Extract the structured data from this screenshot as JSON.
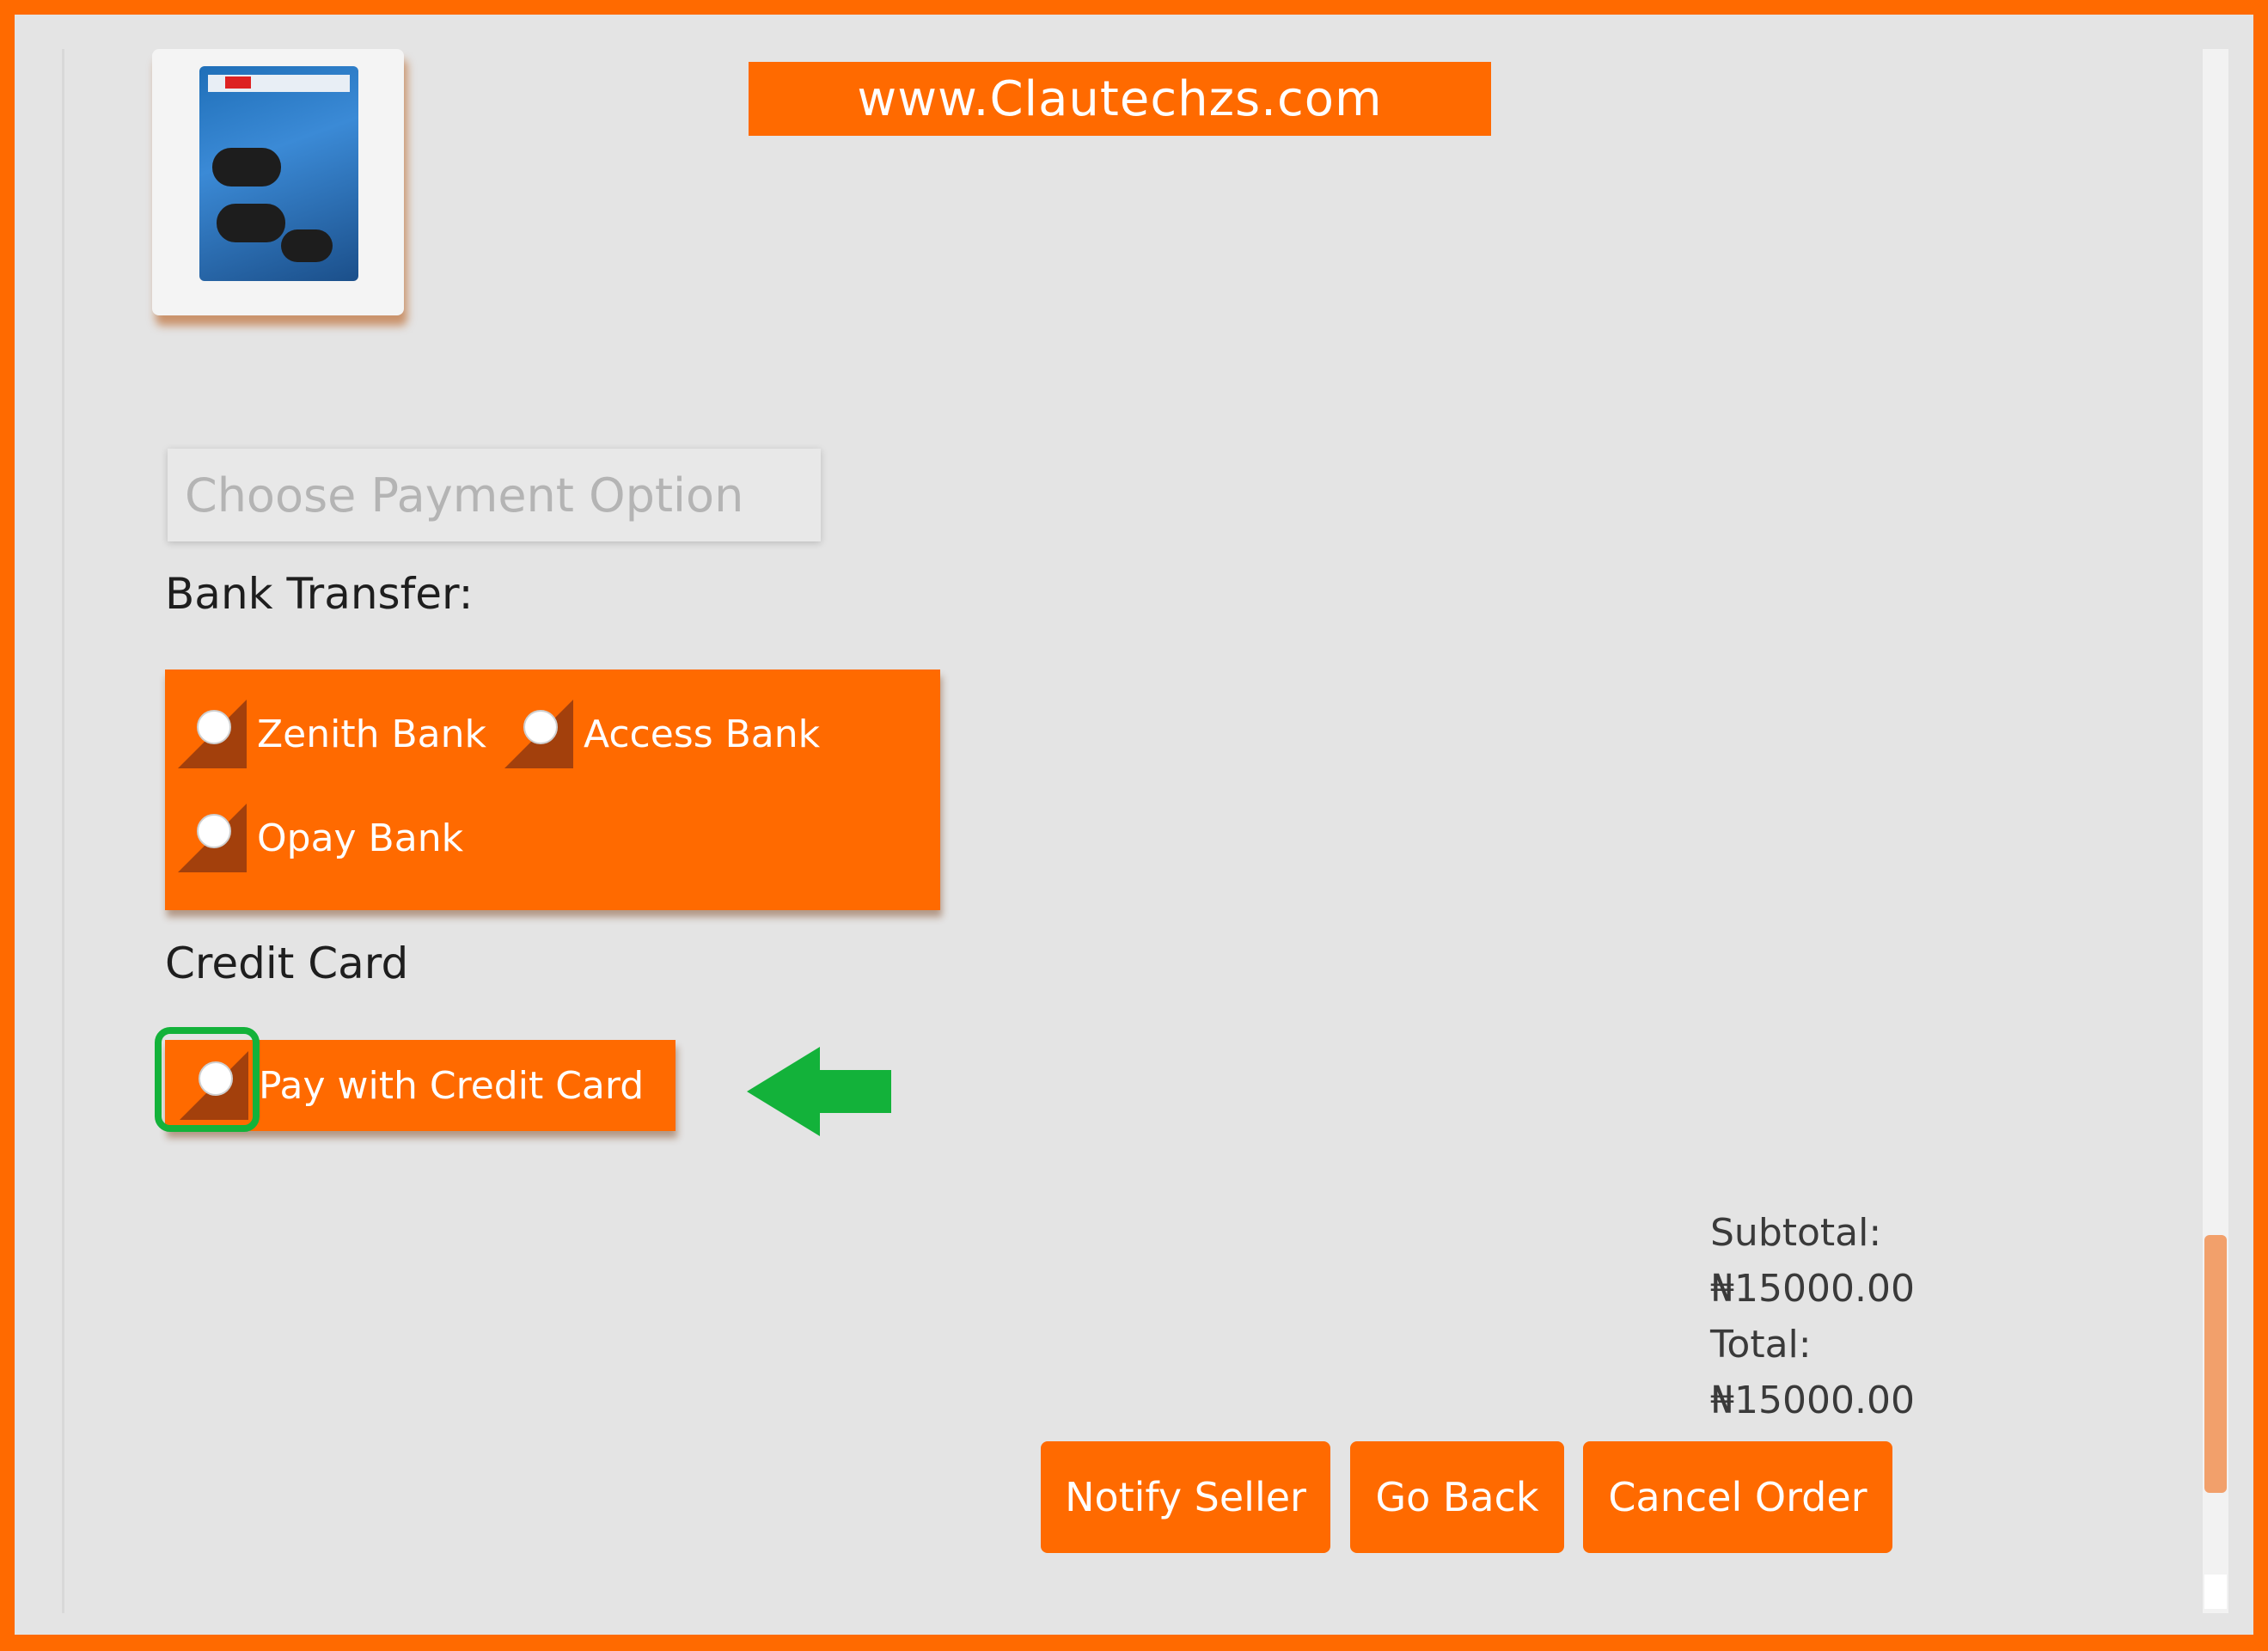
{
  "watermark": {
    "text": "www.Clautechzs.com"
  },
  "payment": {
    "heading": "Choose Payment Option",
    "bank_transfer": {
      "label": "Bank Transfer:",
      "options": [
        "Zenith Bank",
        "Access Bank",
        "Opay Bank"
      ]
    },
    "credit_card": {
      "label": "Credit Card",
      "option": "Pay with Credit Card"
    }
  },
  "summary": {
    "subtotal_label": "Subtotal:",
    "subtotal_value": "₦15000.00",
    "total_label": "Total:",
    "total_value": "₦15000.00"
  },
  "actions": {
    "notify": "Notify Seller",
    "back": "Go Back",
    "cancel": "Cancel Order"
  },
  "colors": {
    "accent": "#ff6a00",
    "highlight": "#13b23a",
    "background": "#e4e4e4"
  }
}
